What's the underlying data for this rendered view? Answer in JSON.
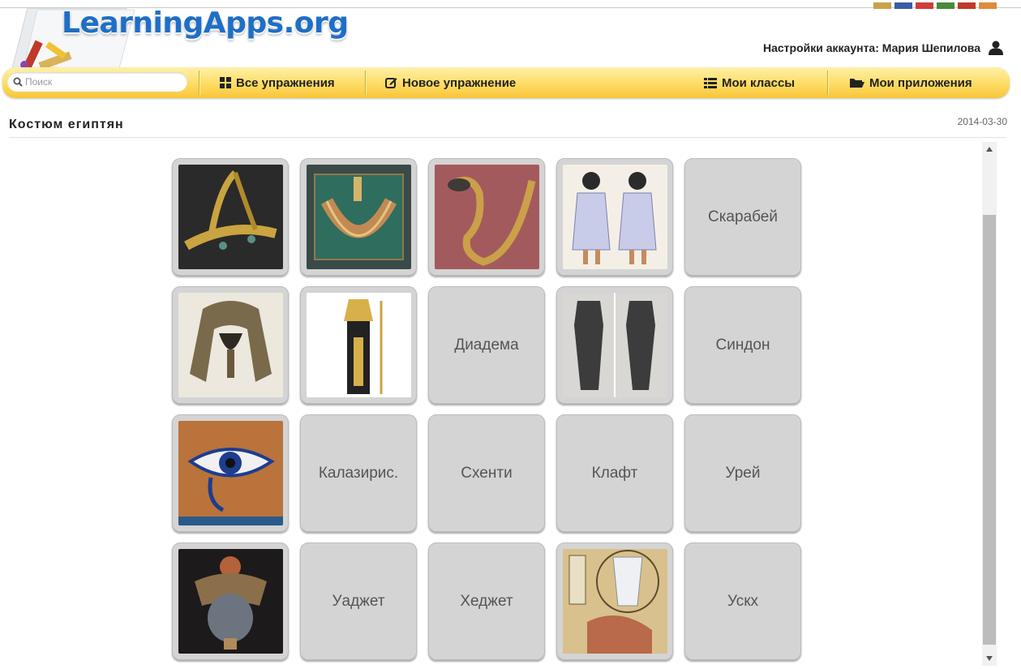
{
  "header": {
    "logo_text": "LearningApps.org",
    "account_label": "Настройки аккаунта: Мария Шепилова",
    "icons": {
      "user": "user-icon"
    }
  },
  "nav": {
    "search_placeholder": "Поиск",
    "all_exercises": "Все упражнения",
    "new_exercise": "Новое упражнение",
    "my_classes": "Мои классы",
    "my_apps": "Мои приложения",
    "icons": {
      "search": "search-icon",
      "all_exercises": "grid-icon",
      "new_exercise": "edit-icon",
      "my_classes": "list-icon",
      "my_apps": "folder-icon"
    },
    "colors": {
      "bar_top": "#fff1a9",
      "bar_bottom": "#f8c53a"
    }
  },
  "page": {
    "title": "Костюм египтян",
    "date": "2014-03-30"
  },
  "cards": [
    {
      "kind": "image",
      "icon": "diadem-photo"
    },
    {
      "kind": "image",
      "icon": "necklace-photo"
    },
    {
      "kind": "image",
      "icon": "uraeus-cobra-photo"
    },
    {
      "kind": "image",
      "icon": "egyptian-dress-figures-photo"
    },
    {
      "kind": "text",
      "label": "Скарабей"
    },
    {
      "kind": "image",
      "icon": "nemes-headdress-photo"
    },
    {
      "kind": "image",
      "icon": "pharaoh-costume-photo"
    },
    {
      "kind": "text",
      "label": "Диадема"
    },
    {
      "kind": "image",
      "icon": "sindon-statues-photo"
    },
    {
      "kind": "text",
      "label": "Синдон"
    },
    {
      "kind": "image",
      "icon": "wedjat-eye-photo"
    },
    {
      "kind": "text",
      "label": "Калазирис."
    },
    {
      "kind": "text",
      "label": "Схенти"
    },
    {
      "kind": "text",
      "label": "Клафт"
    },
    {
      "kind": "text",
      "label": "Урей"
    },
    {
      "kind": "image",
      "icon": "scarab-amulet-photo"
    },
    {
      "kind": "text",
      "label": "Уаджет"
    },
    {
      "kind": "text",
      "label": "Хеджет"
    },
    {
      "kind": "image",
      "icon": "hedjet-crown-painting"
    },
    {
      "kind": "text",
      "label": "Ускх"
    }
  ],
  "scrollbar": {
    "position_fraction": 0.1
  }
}
